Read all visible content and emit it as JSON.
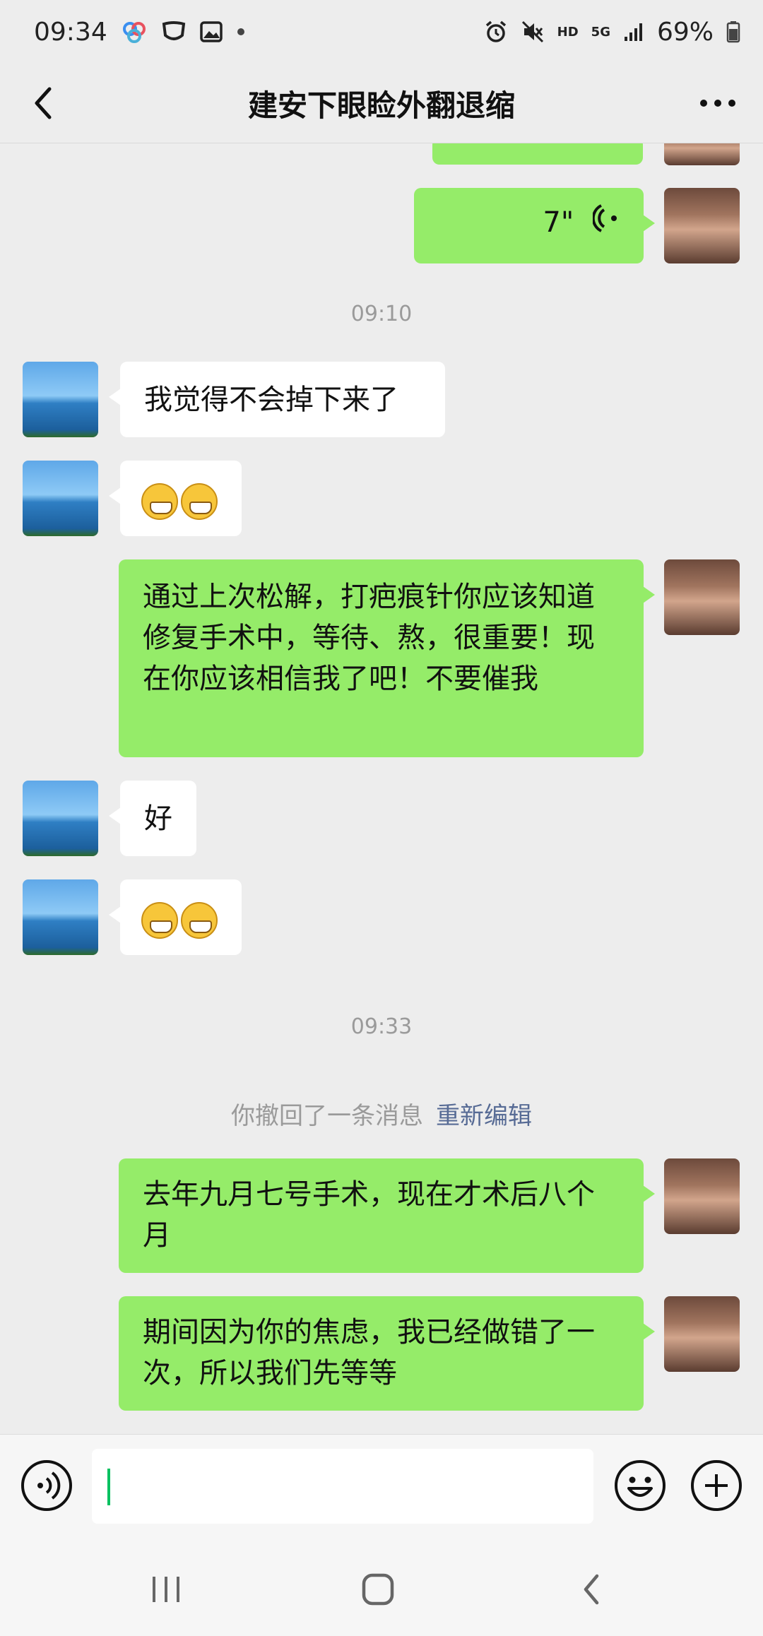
{
  "status_bar": {
    "time": "09:34",
    "battery": "69%",
    "network": "5G",
    "hd": "HD"
  },
  "header": {
    "title": "建安下眼睑外翻退缩"
  },
  "messages": {
    "m0_voice_duration": "7\"",
    "t1": "09:10",
    "m1": "我觉得不会掉下来了",
    "m3": "通过上次松解，打疤痕针你应该知道修复手术中，等待、熬，很重要！现在你应该相信我了吧！不要催我",
    "m4": "好",
    "t2": "09:33",
    "recall": "你撤回了一条消息",
    "recall_action": "重新编辑",
    "m6": "去年九月七号手术，现在才术后八个月",
    "m7": "期间因为你的焦虑，我已经做错了一次，所以我们先等等"
  },
  "input": {
    "value": ""
  },
  "icons": {
    "voice": "voice-mode-icon",
    "emoji": "emoji-icon",
    "plus": "plus-icon",
    "back": "back-icon",
    "more": "more-icon"
  },
  "colors": {
    "my_bubble": "#95ec69",
    "other_bubble": "#ffffff",
    "link": "#576b95",
    "background": "#ededed"
  }
}
